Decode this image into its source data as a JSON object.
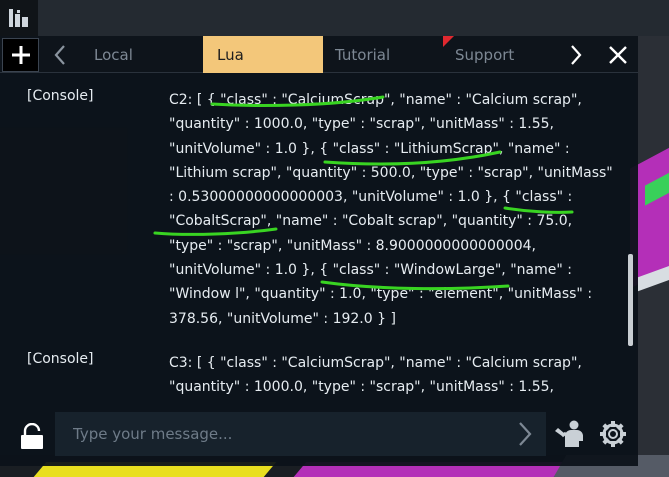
{
  "tabs": [
    {
      "label": "Local"
    },
    {
      "label": "Lua"
    },
    {
      "label": "Tutorial"
    },
    {
      "label": "Support"
    }
  ],
  "active_tab": "Lua",
  "colors": {
    "active_tab": "#f3c77a",
    "text": "#e6ecf1",
    "marker": "#39d422",
    "notification": "#e0282f"
  },
  "icons": {
    "corner": "game-menu-icon",
    "add": "plus-icon",
    "prev": "chevron-left-icon",
    "next": "chevron-right-icon",
    "close": "close-icon",
    "lock": "unlock-icon",
    "send": "send-arrow-icon",
    "people": "people-icon",
    "settings": "gear-icon"
  },
  "messages": [
    {
      "sender": "[Console]",
      "lines": [
        "C2: [ { \"class\" : \"CalciumScrap\", \"name\" : \"Calcium scrap\",",
        "\"quantity\" : 1000.0, \"type\" : \"scrap\", \"unitMass\" : 1.55,",
        "\"unitVolume\" : 1.0 }, { \"class\" : \"LithiumScrap\", \"name\" :",
        "\"Lithium scrap\", \"quantity\" : 500.0, \"type\" : \"scrap\", \"unitMass\"",
        ": 0.53000000000000003, \"unitVolume\" : 1.0 }, { \"class\" :",
        "\"CobaltScrap\", \"name\" : \"Cobalt scrap\", \"quantity\" : 75.0,",
        "\"type\" : \"scrap\", \"unitMass\" : 8.9000000000000004,",
        "\"unitVolume\" : 1.0 }, { \"class\" : \"WindowLarge\", \"name\" :",
        "\"Window l\", \"quantity\" : 1.0, \"type\" : \"element\", \"unitMass\" :",
        "378.56, \"unitVolume\" : 192.0 } ]"
      ]
    },
    {
      "sender": "[Console]",
      "lines": [
        "C3: [ { \"class\" : \"CalciumScrap\", \"name\" : \"Calcium scrap\",",
        "\"quantity\" : 1000.0, \"type\" : \"scrap\", \"unitMass\" : 1.55,"
      ]
    }
  ],
  "input": {
    "placeholder": "Type your message...",
    "value": ""
  }
}
